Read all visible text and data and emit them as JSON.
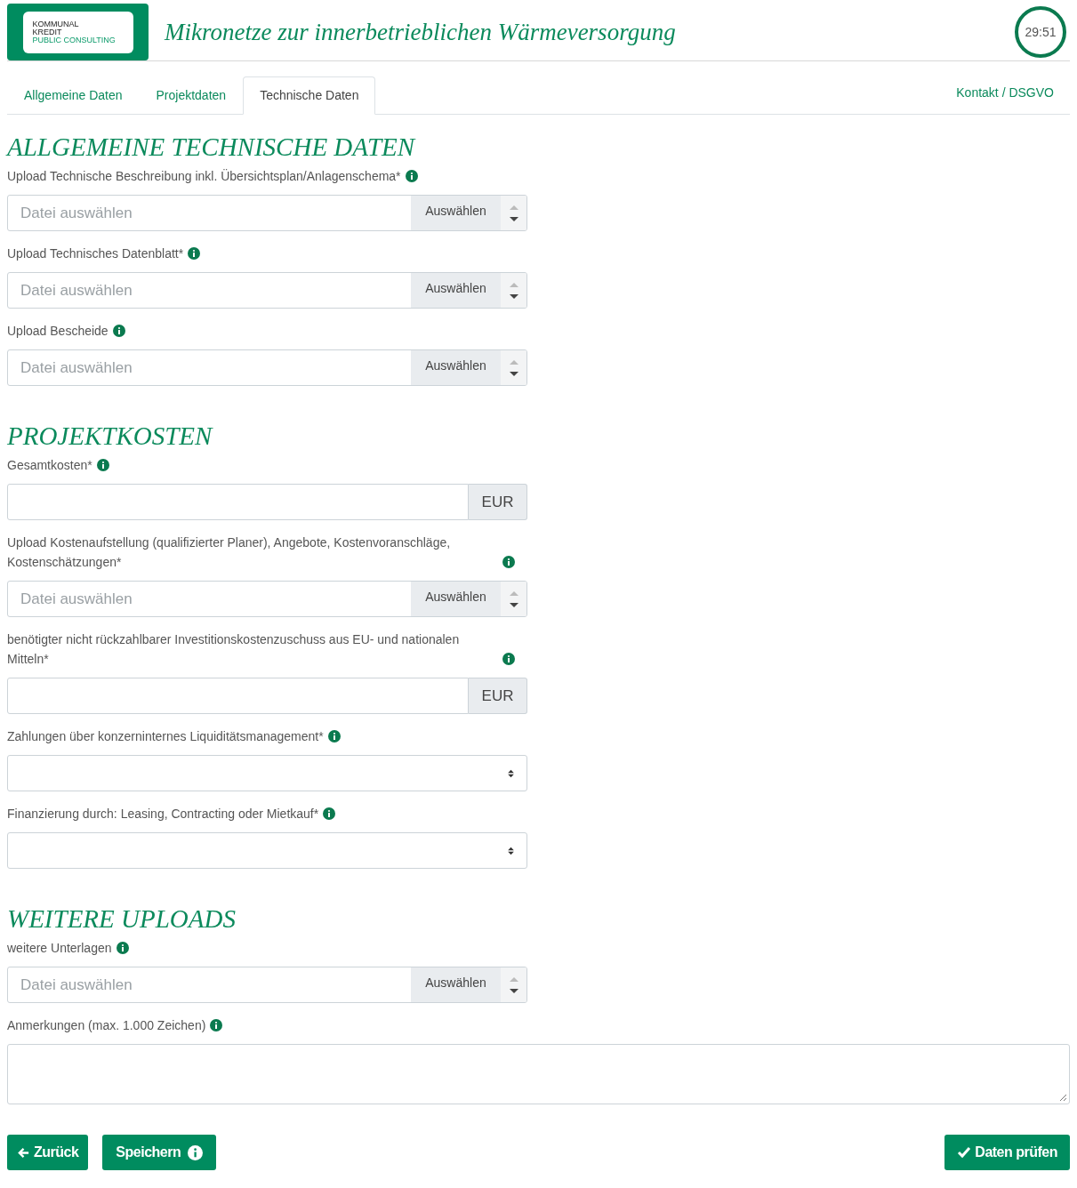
{
  "header": {
    "logo_lines": [
      "KOMMUNAL",
      "KREDIT",
      "PUBLIC CONSULTING"
    ],
    "title": "Mikronetze zur innerbetrieblichen Wärmeversorgung",
    "timer": "29:51"
  },
  "tabs": [
    {
      "label": "Allgemeine Daten",
      "selected": false
    },
    {
      "label": "Projektdaten",
      "selected": false
    },
    {
      "label": "Technische Daten",
      "selected": true
    }
  ],
  "contact_link": "Kontakt / DSGVO",
  "sections": [
    {
      "heading": "ALLGEMEINE TECHNISCHE DATEN",
      "fields": [
        {
          "kind": "file",
          "label": "Upload Technische Beschreibung inkl. Übersichtsplan/Anlagenschema*",
          "placeholder": "Datei auswählen",
          "button": "Auswählen"
        },
        {
          "kind": "file",
          "label": "Upload Technisches Datenblatt*",
          "placeholder": "Datei auswählen",
          "button": "Auswählen"
        },
        {
          "kind": "file",
          "label": "Upload Bescheide",
          "placeholder": "Datei auswählen",
          "button": "Auswählen"
        }
      ]
    },
    {
      "heading": "PROJEKTKOSTEN",
      "fields": [
        {
          "kind": "currency",
          "label": "Gesamtkosten*",
          "unit": "EUR"
        },
        {
          "kind": "file",
          "label": "Upload Kostenaufstellung (qualifizierter Planer), Angebote, Kostenvoranschläge, Kostenschätzungen*",
          "placeholder": "Datei auswählen",
          "button": "Auswählen"
        },
        {
          "kind": "currency",
          "label": "benötigter nicht rückzahlbarer Investitionskostenzuschuss aus EU- und nationalen Mitteln*",
          "unit": "EUR"
        },
        {
          "kind": "select",
          "label": "Zahlungen über konzerninternes Liquiditätsmanagement*"
        },
        {
          "kind": "select",
          "label": "Finanzierung durch: Leasing, Contracting oder Mietkauf*"
        }
      ]
    },
    {
      "heading": "WEITERE UPLOADS",
      "fields": [
        {
          "kind": "file",
          "label": "weitere Unterlagen",
          "placeholder": "Datei auswählen",
          "button": "Auswählen"
        },
        {
          "kind": "textarea",
          "label": "Anmerkungen (max. 1.000 Zeichen)"
        }
      ]
    }
  ],
  "buttons": {
    "back": "Zurück",
    "save": "Speichern",
    "check": "Daten prüfen"
  }
}
